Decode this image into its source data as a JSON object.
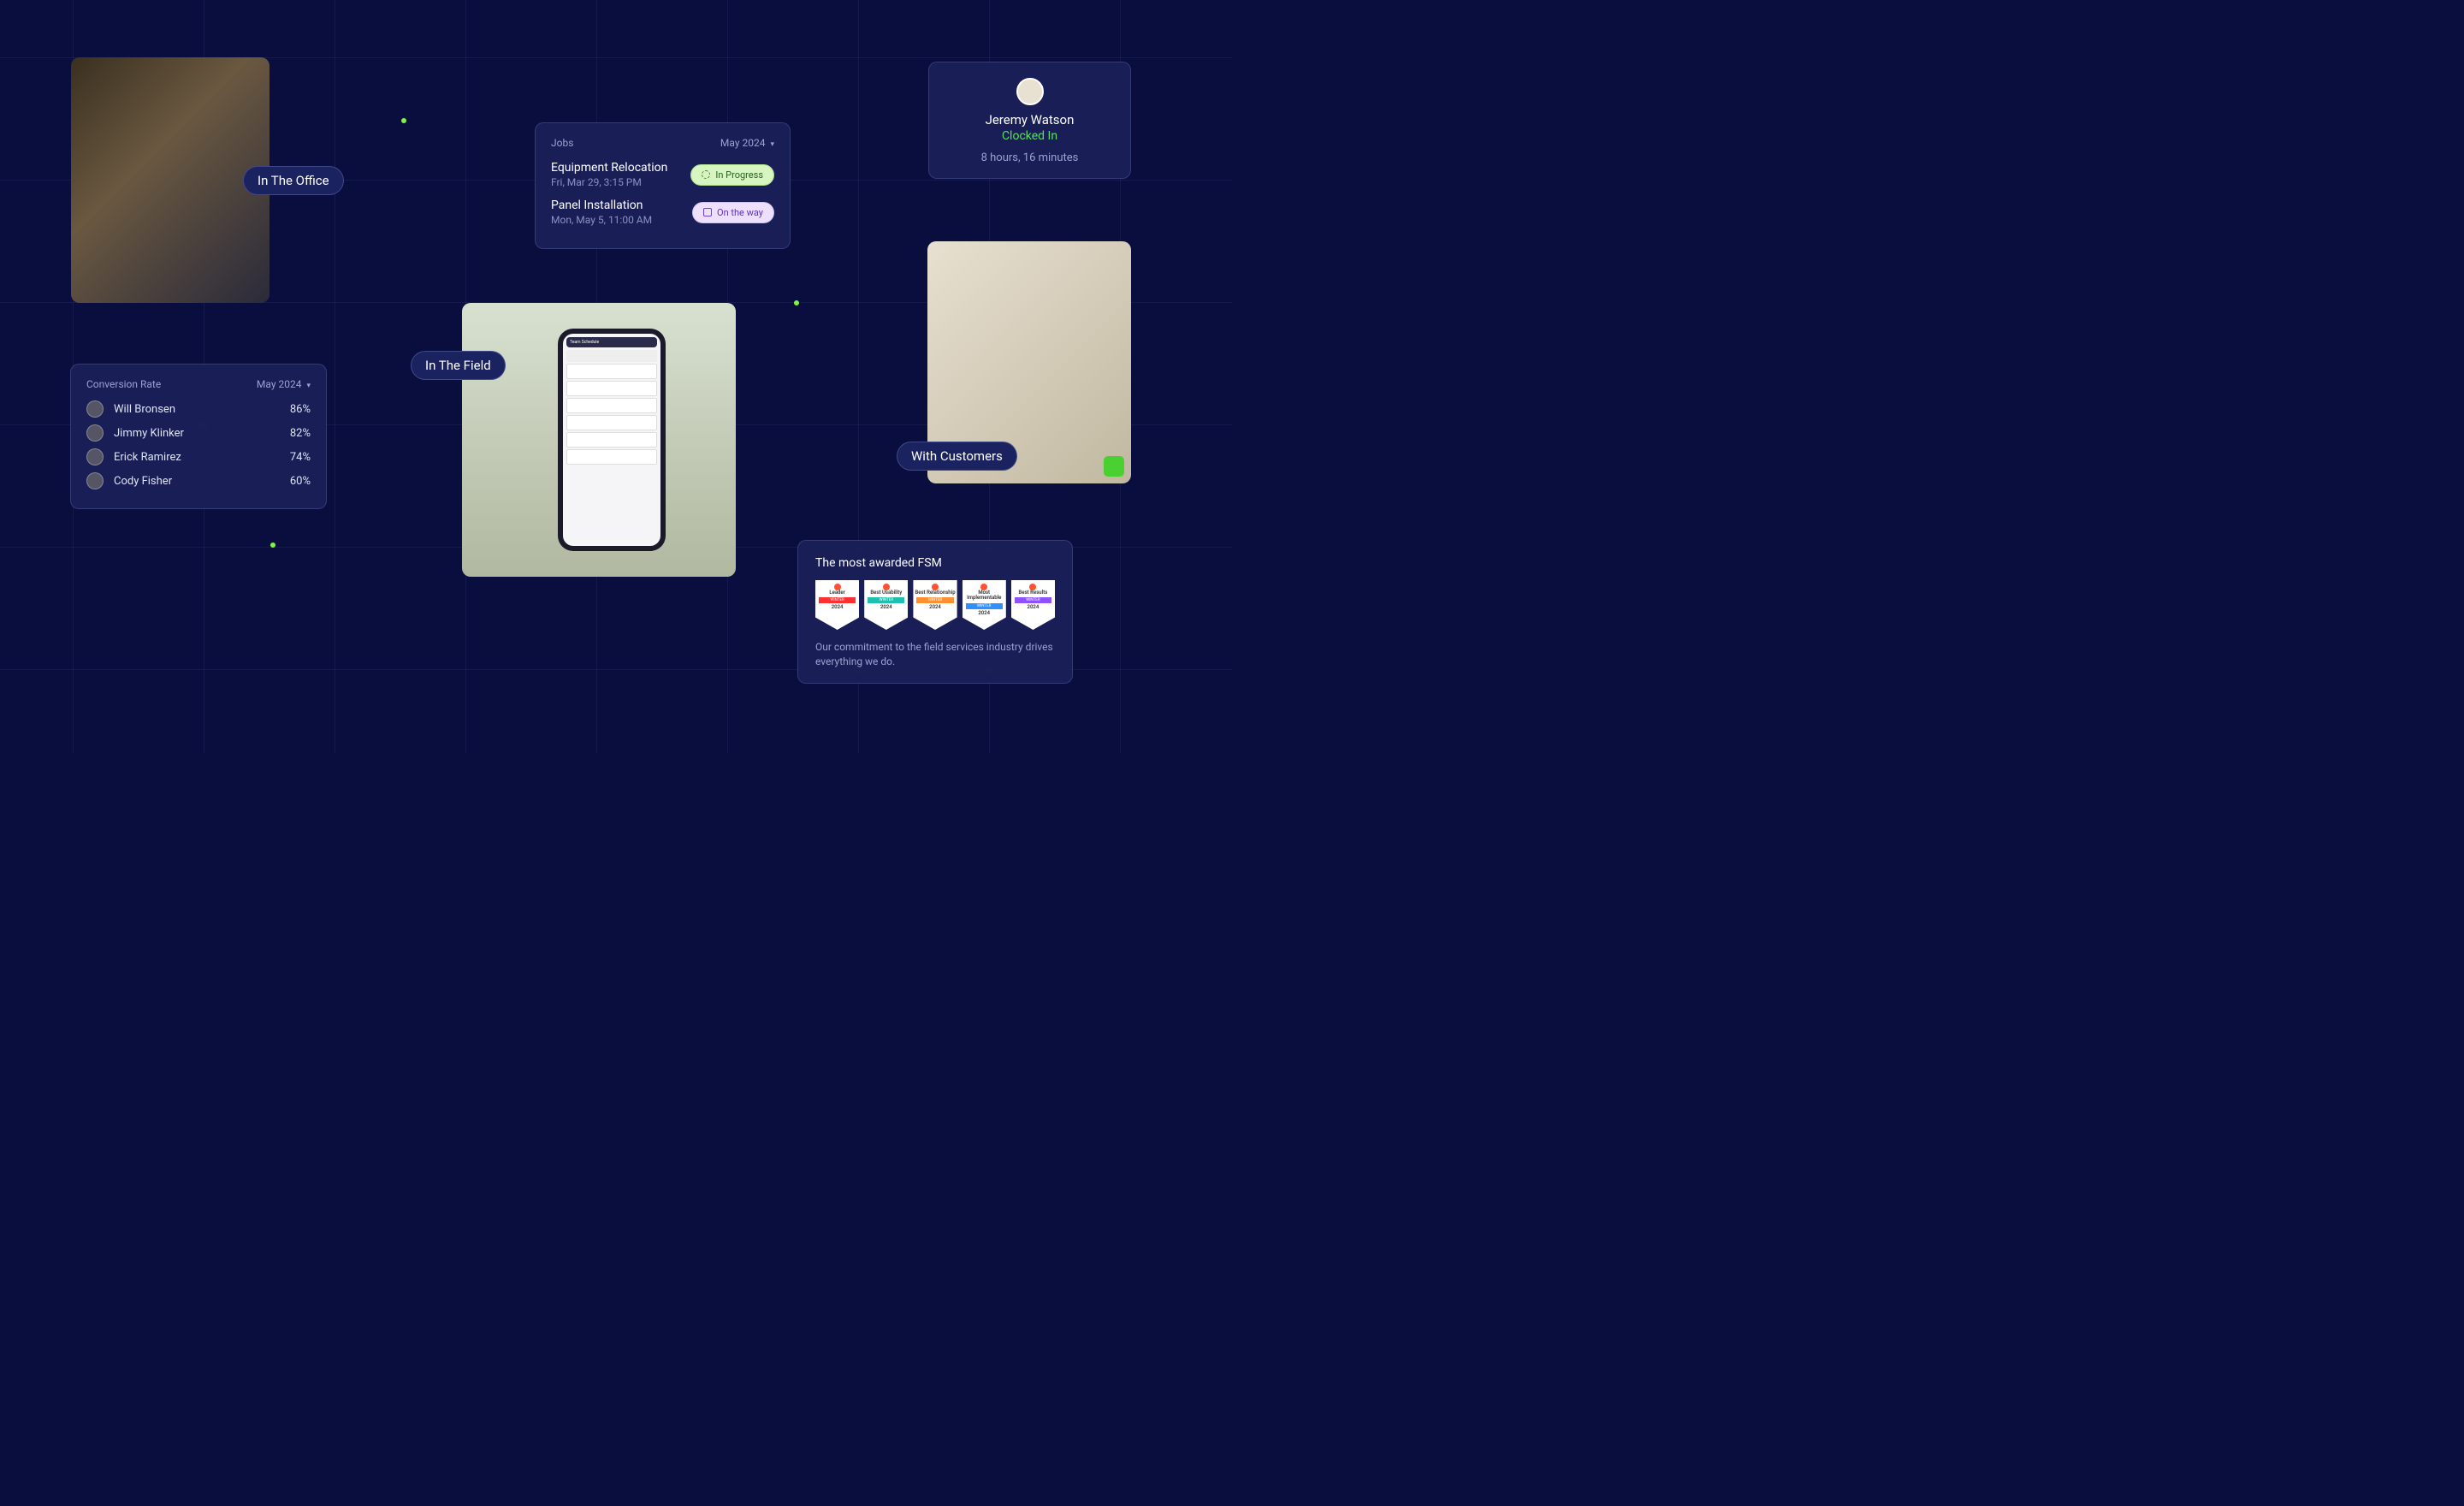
{
  "pills": {
    "office": "In The Office",
    "field": "In The Field",
    "customers": "With Customers"
  },
  "jobs": {
    "title": "Jobs",
    "period": "May 2024",
    "items": [
      {
        "title": "Equipment Relocation",
        "time": "Fri, Mar 29, 3:15 PM",
        "status": "In Progress",
        "kind": "progress"
      },
      {
        "title": "Panel Installation",
        "time": "Mon, May 5, 11:00 AM",
        "status": "On the way",
        "kind": "onway"
      }
    ]
  },
  "clock": {
    "name": "Jeremy Watson",
    "status": "Clocked In",
    "duration": "8 hours, 16 minutes"
  },
  "conversion": {
    "title": "Conversion Rate",
    "period": "May 2024",
    "rows": [
      {
        "name": "Will Bronsen",
        "pct": "86%"
      },
      {
        "name": "Jimmy Klinker",
        "pct": "82%"
      },
      {
        "name": "Erick Ramirez",
        "pct": "74%"
      },
      {
        "name": "Cody Fisher",
        "pct": "60%"
      }
    ]
  },
  "awards": {
    "title": "The most awarded FSM",
    "desc": "Our commitment to the field services industry drives everything we do.",
    "season": "WINTER",
    "year": "2024",
    "badges": [
      {
        "cat": "Leader",
        "color": "red"
      },
      {
        "cat": "Best Usability",
        "color": "teal"
      },
      {
        "cat": "Best Relationship",
        "color": "orange"
      },
      {
        "cat": "Most Implementable",
        "color": "blue"
      },
      {
        "cat": "Best Results",
        "color": "purple"
      }
    ]
  },
  "phone": {
    "header": "Team Schedule"
  }
}
